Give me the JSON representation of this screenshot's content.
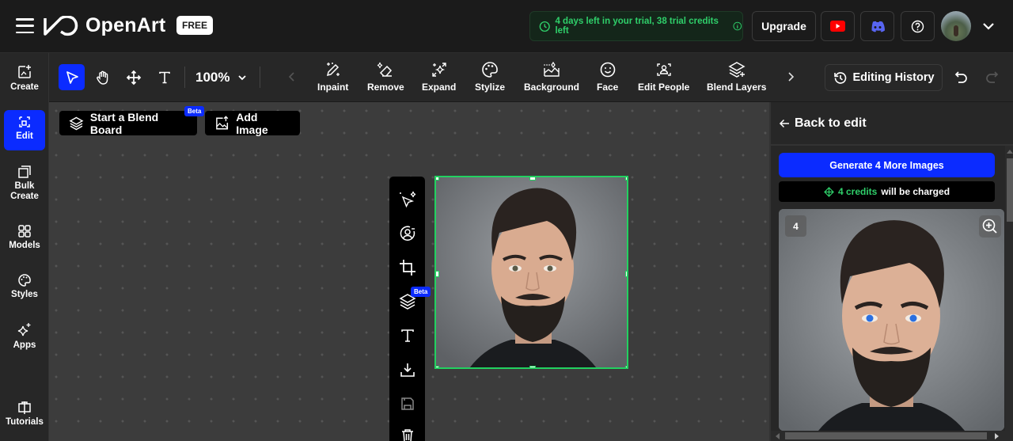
{
  "app": {
    "name": "OpenArt",
    "plan_badge": "FREE"
  },
  "header": {
    "trial_text": "4 days left in your trial, 38 trial credits left",
    "upgrade_label": "Upgrade"
  },
  "sidebar": {
    "items": [
      {
        "label": "Create"
      },
      {
        "label": "Edit",
        "active": true
      },
      {
        "label": "Bulk Create"
      },
      {
        "label": "Models"
      },
      {
        "label": "Styles"
      },
      {
        "label": "Apps"
      },
      {
        "label": "Tutorials"
      }
    ]
  },
  "toolbar": {
    "zoom_level": "100%",
    "features": [
      {
        "label": "Inpaint"
      },
      {
        "label": "Remove"
      },
      {
        "label": "Expand"
      },
      {
        "label": "Stylize"
      },
      {
        "label": "Background"
      },
      {
        "label": "Face"
      },
      {
        "label": "Edit People"
      },
      {
        "label": "Blend Layers"
      }
    ],
    "history_label": "Editing History"
  },
  "canvas": {
    "blend_board_label": "Start a Blend Board",
    "add_image_label": "Add Image",
    "beta_label": "Beta"
  },
  "right_panel": {
    "back_label": "Back to edit",
    "generate_label": "Generate 4 More Images",
    "credits_amount": "4 credits",
    "credits_suffix": "will be charged",
    "result_number": "4"
  },
  "colors": {
    "accent": "#0b2bff",
    "success": "#2fcf6a",
    "selection": "#22d160"
  }
}
